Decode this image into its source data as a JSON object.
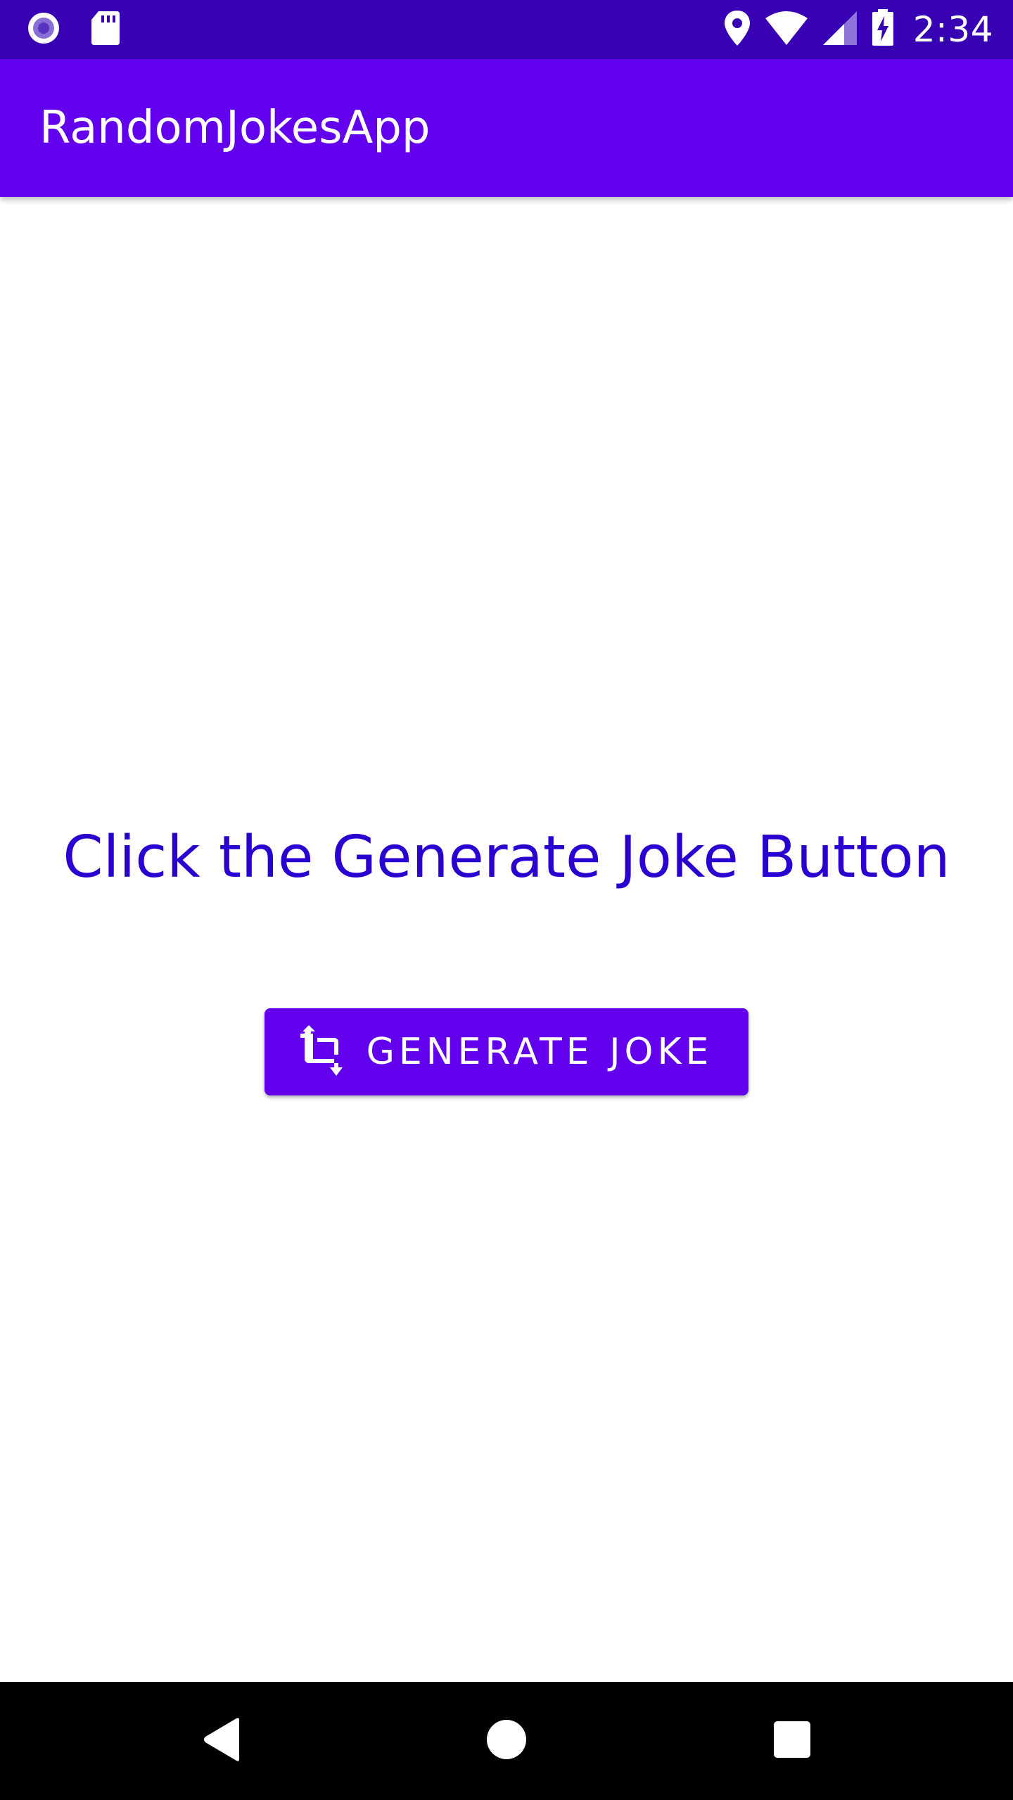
{
  "status_bar": {
    "time": "2:34",
    "icons": [
      "record-icon",
      "sd-card-icon",
      "location-icon",
      "wifi-icon",
      "cell-signal-icon",
      "battery-charging-icon"
    ]
  },
  "app_bar": {
    "title": "RandomJokesApp"
  },
  "main": {
    "joke_text": "Click the Generate Joke Button",
    "generate_button": {
      "label": "GENERATE JOKE",
      "icon": "crop-icon"
    }
  },
  "nav_bar": {
    "buttons": [
      "back-icon",
      "home-icon",
      "recents-icon"
    ]
  },
  "colors": {
    "status_bar": "#3700b3",
    "primary": "#6200ee",
    "joke_text": "#2a00d1",
    "nav_bar": "#000000",
    "background": "#ffffff"
  }
}
